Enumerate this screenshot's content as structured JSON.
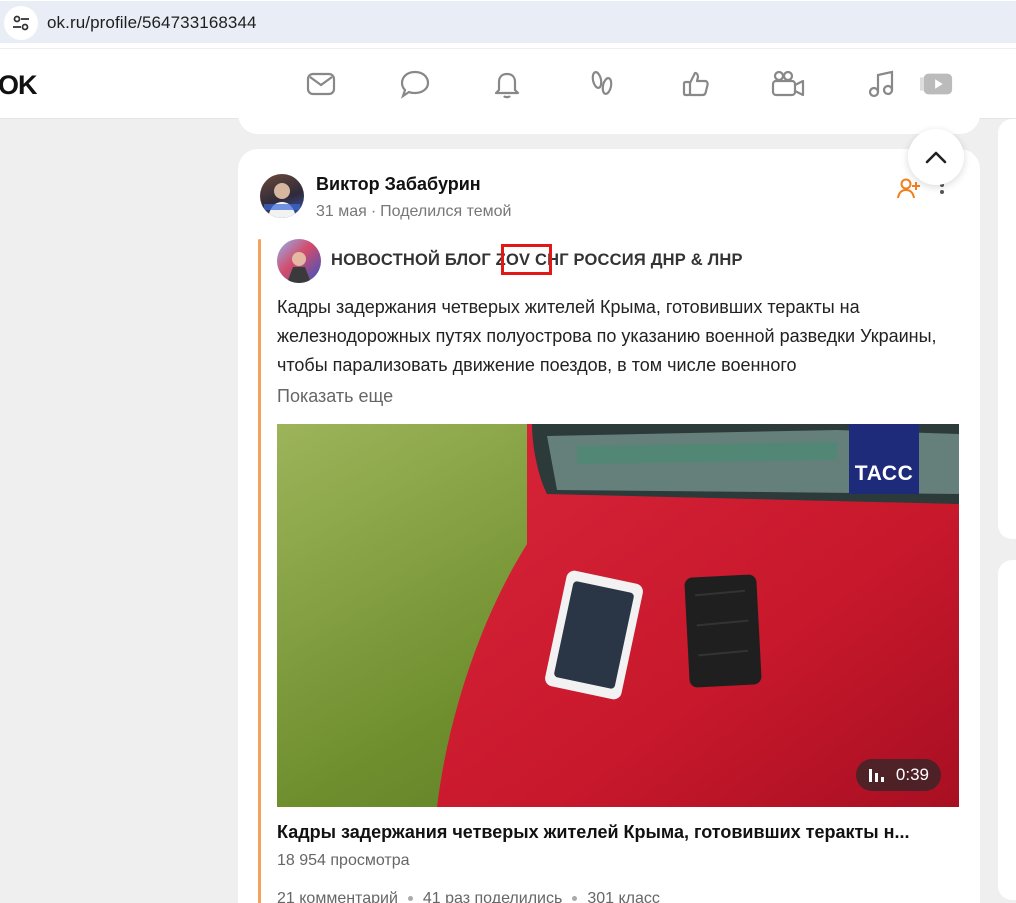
{
  "browser": {
    "url": "ok.ru/profile/564733168344"
  },
  "header": {
    "logo": "OK",
    "nav_icons": [
      "envelope-icon",
      "chat-bubble-icon",
      "bell-icon",
      "footprints-icon",
      "thumbs-up-icon",
      "video-camera-icon",
      "music-note-icon",
      "video-play-icon"
    ]
  },
  "post": {
    "author": "Виктор Забабурин",
    "date": "31 мая",
    "action": "Поделился темой",
    "group_name": "НОВОСТНОЙ БЛОГ ZOV СНГ РОССИЯ ДНР & ЛНР",
    "highlight": "ZOV",
    "text": "Кадры задержания четверых жителей Крыма, готовивших теракты на железнодорожных путях полуострова по указанию военной разведки Украины, чтобы парализовать движение поездов, в том числе военного",
    "show_more": "Показать еще",
    "video": {
      "watermark": "ТАСС",
      "duration": "0:39",
      "title": "Кадры задержания четверых жителей Крыма, готовивших теракты н...",
      "views": "18 954 просмотра"
    },
    "stats": {
      "comments": "21 комментарий",
      "shares": "41 раз поделились",
      "likes": "301 класс"
    }
  },
  "colors": {
    "accent_orange": "#f5a15b",
    "highlight_red": "#e01818",
    "tass_blue": "#1e2a7a"
  }
}
